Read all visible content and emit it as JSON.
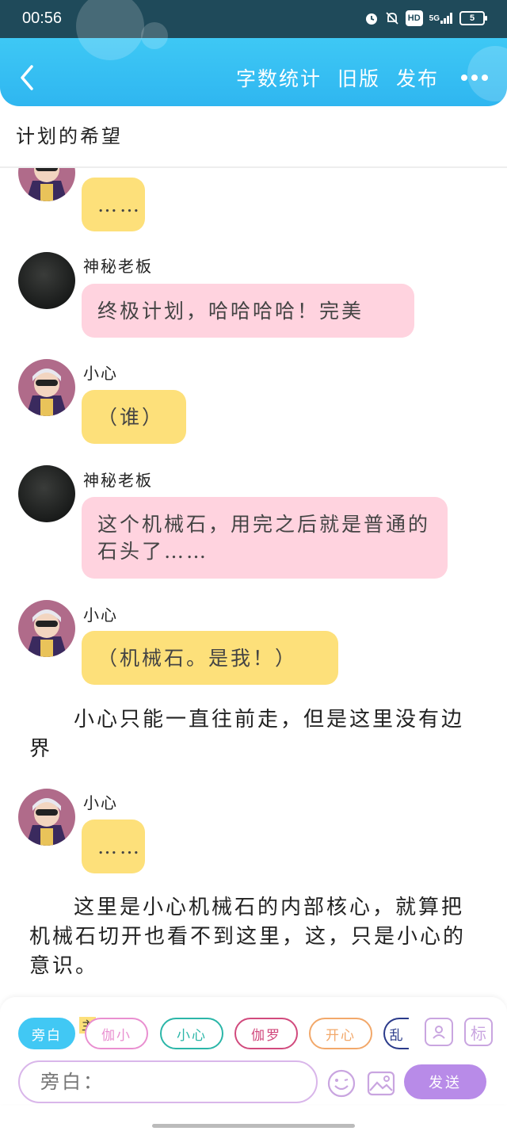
{
  "status": {
    "time": "00:56",
    "network": "5G",
    "hd": "HD",
    "battery": "5"
  },
  "header": {
    "actions": [
      "字数统计",
      "旧版",
      "发布"
    ],
    "title": "计划的希望"
  },
  "messages": [
    {
      "speaker": "",
      "text": "……"
    },
    {
      "speaker": "神秘老板",
      "text": "终极计划，哈哈哈哈！完美"
    },
    {
      "speaker": "小心",
      "text": "（谁）"
    },
    {
      "speaker": "神秘老板",
      "text": "这个机械石，用完之后就是普通的石头了……"
    },
    {
      "speaker": "小心",
      "text": "（机械石。是我！）"
    },
    {
      "narration": "小心只能一直往前走，但是这里没有边界"
    },
    {
      "speaker": "小心",
      "text": "……"
    },
    {
      "narration": "这里是小心机械石的内部核心，就算把机械石切开也看不到这里，这，只是小心的意识。"
    }
  ],
  "composer": {
    "chips": [
      "旁白",
      "伽小",
      "小心",
      "伽罗",
      "开心",
      "乱"
    ],
    "main_tag": "主",
    "tag_button": "标",
    "placeholder": "旁白：",
    "send": "发送"
  },
  "colors": {
    "accent": "#3ec8f5",
    "yellow_bubble": "#fde07a",
    "pink_bubble": "#ffd3df",
    "send": "#b88be8"
  }
}
